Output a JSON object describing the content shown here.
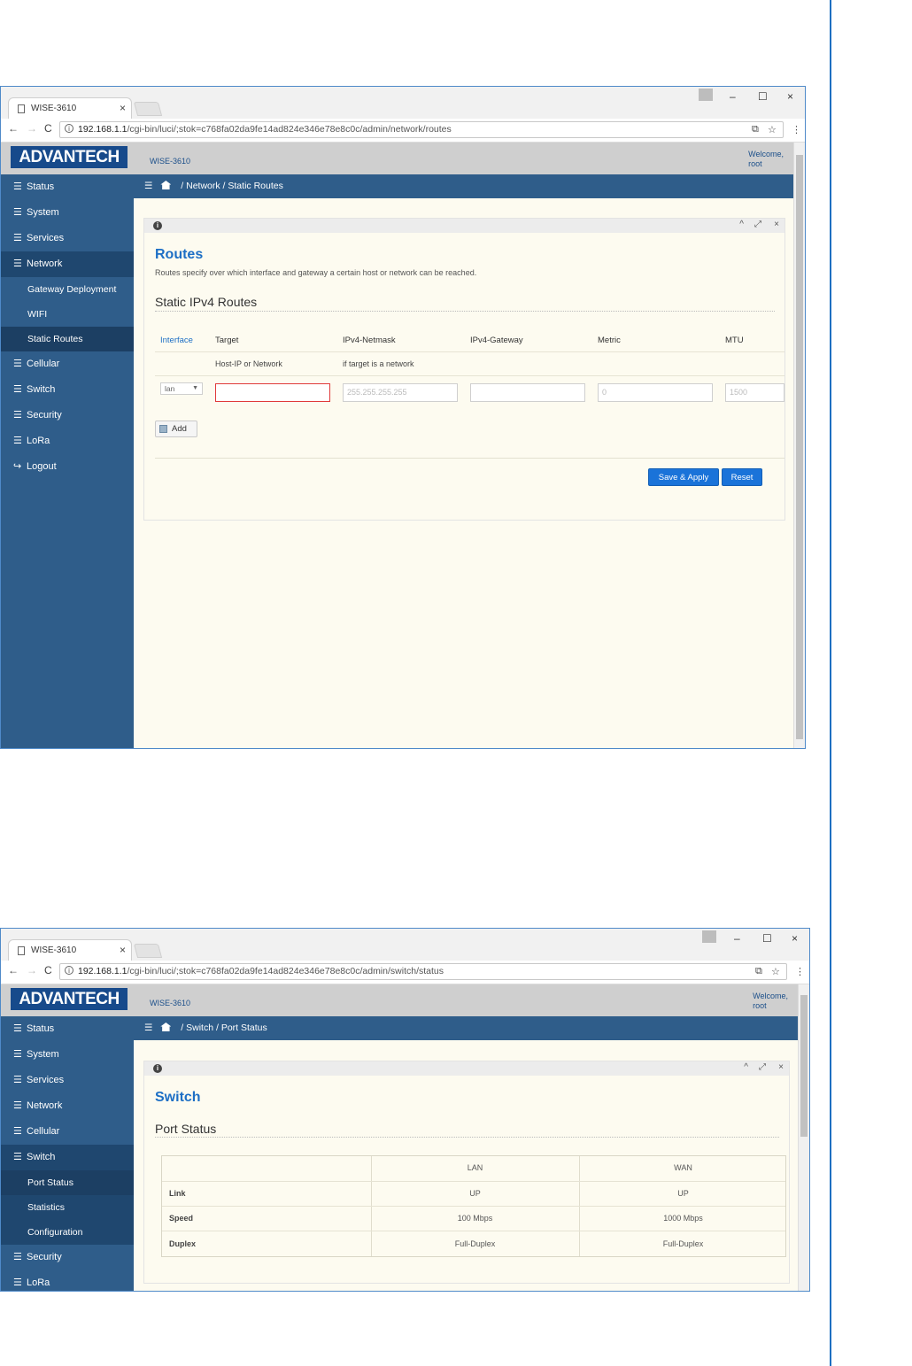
{
  "window": {
    "tab_title": "WISE-3610",
    "tab_close": "×",
    "minimize": "–",
    "maximize": "☐",
    "close": "×"
  },
  "screens": [
    {
      "url_host": "192.168.1.1",
      "url_path": "/cgi-bin/luci/;stok=c768fa02da9fe14ad824e346e78e8c0c/admin/network/routes",
      "logo": "ADVANTECH",
      "hostname": "WISE-3610",
      "welcome": "Welcome,",
      "user": "root",
      "sidebar": [
        "Status",
        "System",
        "Services",
        "Network",
        "Cellular",
        "Switch",
        "Security",
        "LoRa",
        "Logout"
      ],
      "network_sub": [
        "Gateway Deployment",
        "WIFI",
        "Static Routes"
      ],
      "crumb_section": "Network",
      "crumb_page": "Static Routes",
      "title": "Routes",
      "description": "Routes specify over which interface and gateway a certain host or network can be reached.",
      "section": "Static IPv4 Routes",
      "columns": [
        "Interface",
        "Target",
        "IPv4-Netmask",
        "IPv4-Gateway",
        "Metric",
        "MTU"
      ],
      "sublabels": [
        "Host-IP or Network",
        "if target is a network"
      ],
      "row": {
        "interface": "lan",
        "target": "",
        "netmask_placeholder": "255.255.255.255",
        "gateway": "",
        "metric_placeholder": "0",
        "mtu_placeholder": "1500"
      },
      "add_label": "Add",
      "save_label": "Save & Apply",
      "reset_label": "Reset"
    },
    {
      "url_host": "192.168.1.1",
      "url_path": "/cgi-bin/luci/;stok=c768fa02da9fe14ad824e346e78e8c0c/admin/switch/status",
      "logo": "ADVANTECH",
      "hostname": "WISE-3610",
      "welcome": "Welcome,",
      "user": "root",
      "sidebar": [
        "Status",
        "System",
        "Services",
        "Network",
        "Cellular",
        "Switch",
        "Security",
        "LoRa"
      ],
      "switch_sub": [
        "Port Status",
        "Statistics",
        "Configuration"
      ],
      "crumb_section": "Switch",
      "crumb_page": "Port Status",
      "title": "Switch",
      "section": "Port Status",
      "port_table": {
        "headers": [
          "",
          "LAN",
          "WAN"
        ],
        "rows": [
          [
            "Link",
            "UP",
            "UP"
          ],
          [
            "Speed",
            "100 Mbps",
            "1000 Mbps"
          ],
          [
            "Duplex",
            "Full-Duplex",
            "Full-Duplex"
          ]
        ]
      }
    }
  ]
}
